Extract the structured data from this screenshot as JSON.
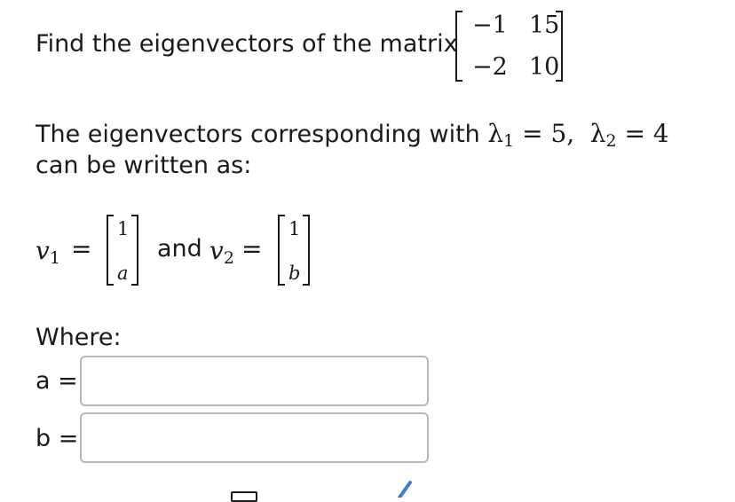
{
  "question": {
    "prompt": "Find the eigenvectors of the matrix",
    "matrix": [
      [
        "−1",
        "15"
      ],
      [
        "−2",
        "10"
      ]
    ],
    "statement_line1": "The eigenvectors corresponding with",
    "lambda1_sym": "λ",
    "lambda1_sub": "1",
    "lambda1_val": "= 5,",
    "lambda2_sym": "λ",
    "lambda2_sub": "2",
    "lambda2_val": "= 4",
    "statement_line2": "can be written as:",
    "v1_sym": "v",
    "v1_sub": "1",
    "v1_eq": "=",
    "v1_top": "1",
    "v1_bottom": "a",
    "and_text": "and",
    "v2_sym": "v",
    "v2_sub": "2",
    "v2_eq": "=",
    "v2_top": "1",
    "v2_bottom": "b",
    "where_label": "Where:"
  },
  "answers": {
    "a_label": "a =",
    "a_value": "",
    "b_label": "b =",
    "b_value": ""
  },
  "colors": {
    "text": "#1a1a1a",
    "input_border": "#b8b8b8"
  }
}
